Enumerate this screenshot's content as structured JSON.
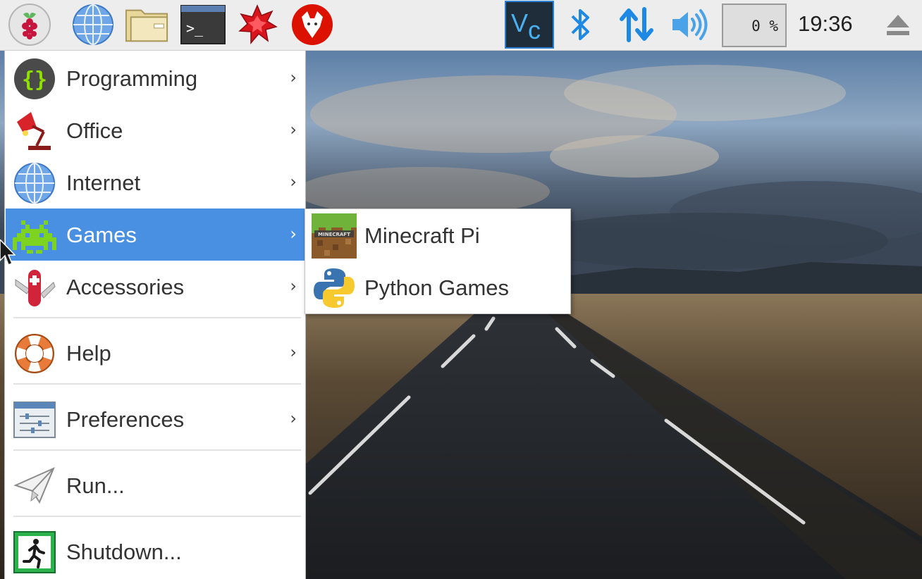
{
  "panel": {
    "launchers": [
      {
        "name": "raspberry-menu-icon"
      },
      {
        "name": "web-browser-icon"
      },
      {
        "name": "file-manager-icon"
      },
      {
        "name": "terminal-icon"
      },
      {
        "name": "mathematica-icon"
      },
      {
        "name": "wolfram-icon"
      }
    ],
    "tray": [
      {
        "name": "vnc-icon"
      },
      {
        "name": "bluetooth-icon"
      },
      {
        "name": "network-icon"
      },
      {
        "name": "volume-icon"
      }
    ],
    "cpu_usage": "0 %",
    "clock": "19:36",
    "eject_icon": "eject-icon"
  },
  "menu": {
    "items": [
      {
        "label": "Programming",
        "icon": "programming-icon",
        "has_submenu": true
      },
      {
        "label": "Office",
        "icon": "office-lamp-icon",
        "has_submenu": true
      },
      {
        "label": "Internet",
        "icon": "globe-icon",
        "has_submenu": true
      },
      {
        "label": "Games",
        "icon": "space-invader-icon",
        "has_submenu": true,
        "selected": true
      },
      {
        "label": "Accessories",
        "icon": "swiss-knife-icon",
        "has_submenu": true
      },
      {
        "label": "Help",
        "icon": "lifebuoy-icon",
        "has_submenu": true
      },
      {
        "label": "Preferences",
        "icon": "preferences-icon",
        "has_submenu": true
      },
      {
        "label": "Run...",
        "icon": "paper-plane-icon",
        "has_submenu": false
      },
      {
        "label": "Shutdown...",
        "icon": "exit-icon",
        "has_submenu": false
      }
    ],
    "arrow": "›"
  },
  "submenu": {
    "items": [
      {
        "label": "Minecraft Pi",
        "icon": "minecraft-icon",
        "icon_text": "MINECRAFT"
      },
      {
        "label": "Python Games",
        "icon": "python-icon"
      }
    ]
  },
  "colors": {
    "selection": "#4a90e2",
    "panel_bg": "#ededed",
    "tray_blue": "#1e88e5"
  }
}
